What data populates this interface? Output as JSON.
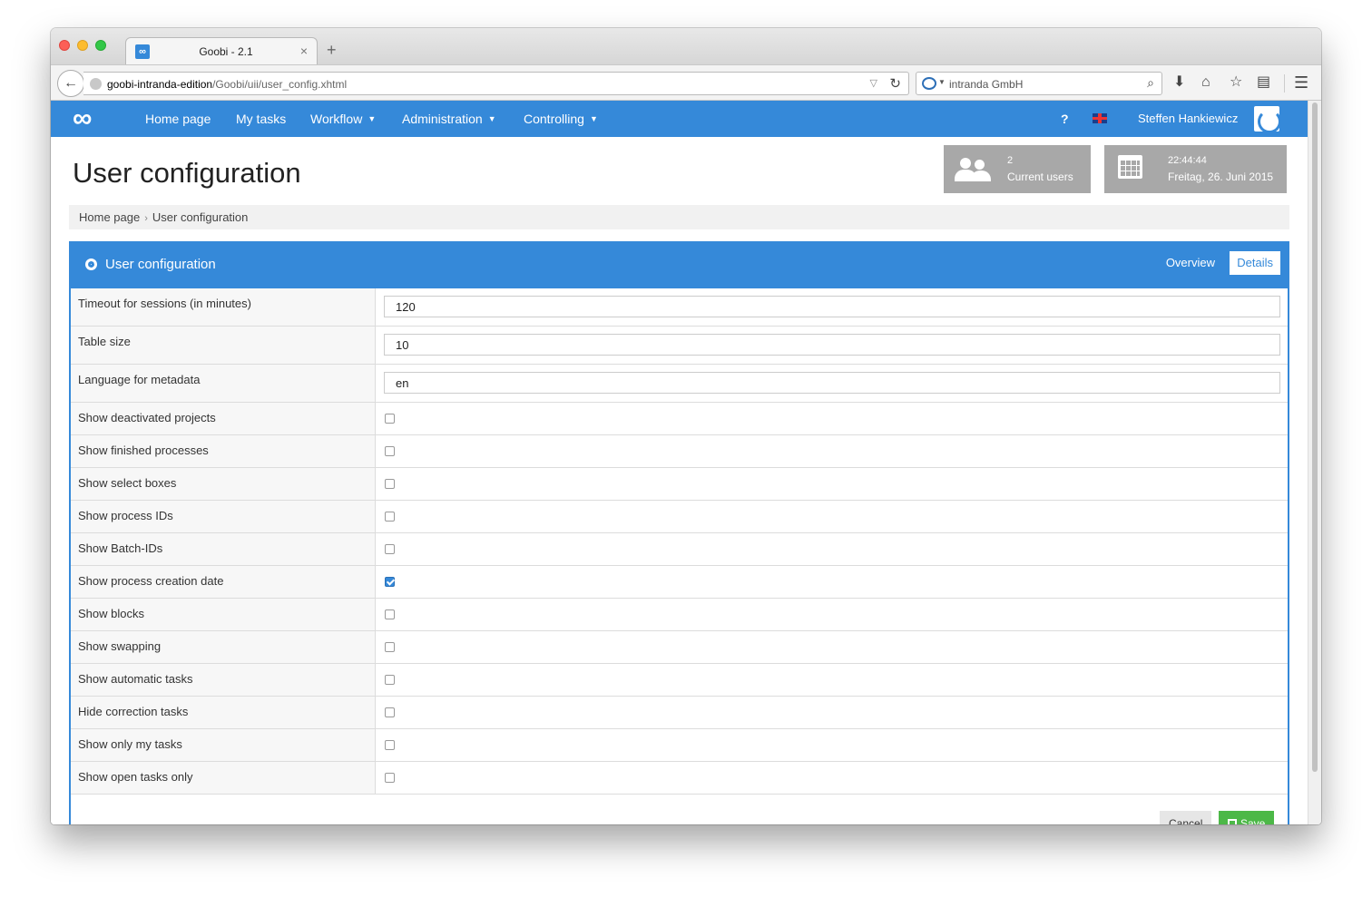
{
  "browser": {
    "tab_title": "Goobi - 2.1",
    "tab_icon": "∞",
    "url_host": "goobi-intranda-edition",
    "url_path": "/Goobi/uii/user_config.xhtml",
    "search_text": "intranda GmbH"
  },
  "topnav": {
    "logo": "∞",
    "items": [
      {
        "label": "Home page"
      },
      {
        "label": "My tasks"
      },
      {
        "label": "Workflow"
      },
      {
        "label": "Administration"
      },
      {
        "label": "Controlling"
      }
    ],
    "help": "?",
    "user": "Steffen Hankiewicz"
  },
  "page": {
    "title": "User configuration",
    "users_box": {
      "count": "2",
      "label": "Current users"
    },
    "date_box": {
      "time": "22:44:44",
      "date": "Freitag, 26. Juni 2015"
    }
  },
  "breadcrumb": {
    "items": [
      "Home page",
      "User configuration"
    ],
    "separator": "›"
  },
  "panel": {
    "title": "User configuration",
    "tabs": {
      "overview": "Overview",
      "details": "Details"
    },
    "text_fields": [
      {
        "label": "Timeout for sessions (in minutes)",
        "value": "120"
      },
      {
        "label": "Table size",
        "value": "10"
      },
      {
        "label": "Language for metadata",
        "value": "en"
      }
    ],
    "checkboxes": [
      {
        "label": "Show deactivated projects",
        "checked": false
      },
      {
        "label": "Show finished processes",
        "checked": false
      },
      {
        "label": "Show select boxes",
        "checked": false
      },
      {
        "label": "Show process IDs",
        "checked": false
      },
      {
        "label": "Show Batch-IDs",
        "checked": false
      },
      {
        "label": "Show process creation date",
        "checked": true
      },
      {
        "label": "Show blocks",
        "checked": false
      },
      {
        "label": "Show swapping",
        "checked": false
      },
      {
        "label": "Show automatic tasks",
        "checked": false
      },
      {
        "label": "Hide correction tasks",
        "checked": false
      },
      {
        "label": "Show only my tasks",
        "checked": false
      },
      {
        "label": "Show open tasks only",
        "checked": false
      }
    ],
    "buttons": {
      "cancel": "Cancel",
      "save": "Save"
    }
  }
}
